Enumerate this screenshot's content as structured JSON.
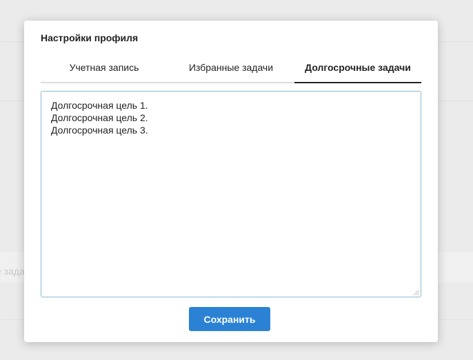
{
  "background": {
    "ghost_text": "е зада"
  },
  "modal": {
    "title": "Настройки профиля",
    "tabs": [
      {
        "label": "Учетная запись",
        "active": false
      },
      {
        "label": "Избранные задачи",
        "active": false
      },
      {
        "label": "Долгосрочные задачи",
        "active": true
      }
    ],
    "editor": {
      "value": "Долгосрочная цель 1.\nДолгосрочная цель 2.\nДолгосрочная цель 3."
    },
    "save_label": "Сохранить"
  },
  "colors": {
    "primary_button": "#2b82d4",
    "editor_border": "#86bcd3",
    "active_tab_underline": "#222222"
  }
}
